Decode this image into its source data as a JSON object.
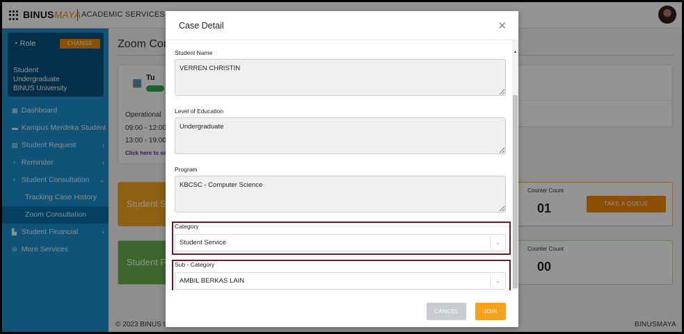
{
  "header": {
    "logo_binus": "BINUS",
    "logo_maya": "MAYA",
    "service": "ACADEMIC SERVICES"
  },
  "sidebar": {
    "role_label": "Role",
    "change_label": "CHANGE",
    "role_lines": [
      "Student",
      "Undergraduate",
      "BINUS University"
    ],
    "items": [
      {
        "label": "Dashboard"
      },
      {
        "label": "Kampus Merdeka Student"
      },
      {
        "label": "Student Request"
      },
      {
        "label": "Reminder"
      },
      {
        "label": "Student Consultation"
      },
      {
        "label": "Tracking Case History"
      },
      {
        "label": "Zoom Consultation"
      },
      {
        "label": "Student Financial"
      },
      {
        "label": "More Services"
      }
    ]
  },
  "main": {
    "title": "Zoom Cor",
    "sched_day": "Tu",
    "operational": "Operational",
    "hours": [
      "09:00 - 12:00",
      "13:00 - 19:00"
    ],
    "click_here": "Click here to se",
    "queues": [
      {
        "name": "Student S",
        "counter_label": "Counter Count",
        "counter": "01",
        "button": "TAKE A QUEUE"
      },
      {
        "name": "Student F",
        "counter_label": "Counter Count",
        "counter": "00"
      }
    ],
    "footer_left": "© 2023 BINUS U",
    "footer_right": "BINUSMAYA"
  },
  "modal": {
    "title": "Case Detail",
    "fields": {
      "student_name": {
        "label": "Student Name",
        "value": "VERREN CHRISTIN"
      },
      "education": {
        "label": "Level of Education",
        "value": "Undergraduate"
      },
      "program": {
        "label": "Program",
        "value": "KBCSC - Computer Science"
      },
      "category": {
        "label": "Category",
        "value": "Student Service"
      },
      "subcategory": {
        "label": "Sub - Category",
        "value": "AMBIL BERKAS LAIN"
      }
    },
    "cancel_label": "CANCEL",
    "join_label": "JOIN"
  },
  "colors": {
    "sidebar_bg": "#1d8fd0",
    "role_card_bg": "#08527f",
    "accent_orange": "#f18700",
    "highlight_border": "#7a1322"
  },
  "icons": [
    "grid-icon",
    "avatar",
    "calendar-icon",
    "close-icon",
    "chevron-down-icon",
    "chevron-left-icon"
  ]
}
